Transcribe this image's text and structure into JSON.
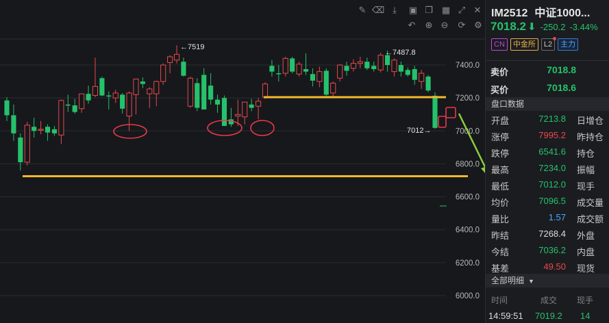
{
  "toolbar": {
    "row1": [
      "pencil-icon",
      "erase-icon",
      "save-icon",
      "camera-icon",
      "copy-icon",
      "grid-icon",
      "expand-icon",
      "close-icon"
    ],
    "row2": [
      "undo-icon",
      "zoom-in-icon",
      "zoom-out-icon",
      "reset-icon",
      "settings-icon"
    ]
  },
  "chart_data": {
    "type": "candlestick",
    "y_ticks": [
      "7400.0",
      "7200.0",
      "7000.0",
      "6800.0",
      "6600.0",
      "6400.0",
      "6200.0",
      "6000.0"
    ],
    "ylim": [
      5960,
      7560
    ],
    "grid": true,
    "candles": [
      {
        "o": 7185,
        "h": 7205,
        "l": 7060,
        "c": 7095
      },
      {
        "o": 7095,
        "h": 7160,
        "l": 6940,
        "c": 6985
      },
      {
        "o": 6960,
        "h": 6985,
        "l": 6760,
        "c": 6810
      },
      {
        "o": 6810,
        "h": 7055,
        "l": 6790,
        "c": 7035
      },
      {
        "o": 7025,
        "h": 7080,
        "l": 6960,
        "c": 7000
      },
      {
        "o": 7010,
        "h": 7060,
        "l": 6980,
        "c": 7010
      },
      {
        "o": 7025,
        "h": 7040,
        "l": 6940,
        "c": 6990
      },
      {
        "o": 7010,
        "h": 7030,
        "l": 6970,
        "c": 6985
      },
      {
        "o": 6975,
        "h": 7190,
        "l": 6920,
        "c": 7185
      },
      {
        "o": 7160,
        "h": 7220,
        "l": 7115,
        "c": 7155
      },
      {
        "o": 7155,
        "h": 7195,
        "l": 7105,
        "c": 7115
      },
      {
        "o": 7135,
        "h": 7225,
        "l": 7110,
        "c": 7225
      },
      {
        "o": 7225,
        "h": 7275,
        "l": 7165,
        "c": 7185
      },
      {
        "o": 7215,
        "h": 7445,
        "l": 7205,
        "c": 7270
      },
      {
        "o": 7320,
        "h": 7330,
        "l": 7210,
        "c": 7215
      },
      {
        "o": 7215,
        "h": 7240,
        "l": 7130,
        "c": 7210
      },
      {
        "o": 7200,
        "h": 7250,
        "l": 7170,
        "c": 7230
      },
      {
        "o": 7220,
        "h": 7230,
        "l": 7105,
        "c": 7135
      },
      {
        "o": 7090,
        "h": 7240,
        "l": 7000,
        "c": 7230
      },
      {
        "o": 7220,
        "h": 7290,
        "l": 7100,
        "c": 7315
      },
      {
        "o": 7300,
        "h": 7325,
        "l": 7260,
        "c": 7285
      },
      {
        "o": 7225,
        "h": 7265,
        "l": 7140,
        "c": 7255
      },
      {
        "o": 7225,
        "h": 7305,
        "l": 7150,
        "c": 7300
      },
      {
        "o": 7300,
        "h": 7410,
        "l": 7280,
        "c": 7400
      },
      {
        "o": 7415,
        "h": 7460,
        "l": 7350,
        "c": 7450
      },
      {
        "o": 7430,
        "h": 7519,
        "l": 7410,
        "c": 7465
      },
      {
        "o": 7420,
        "h": 7445,
        "l": 7330,
        "c": 7335
      },
      {
        "o": 7150,
        "h": 7330,
        "l": 7140,
        "c": 7320
      },
      {
        "o": 7290,
        "h": 7320,
        "l": 7120,
        "c": 7140
      },
      {
        "o": 7340,
        "h": 7380,
        "l": 7130,
        "c": 7130
      },
      {
        "o": 7275,
        "h": 7350,
        "l": 7160,
        "c": 7190
      },
      {
        "o": 7190,
        "h": 7220,
        "l": 7110,
        "c": 7160
      },
      {
        "o": 7200,
        "h": 7215,
        "l": 7030,
        "c": 7030
      },
      {
        "o": 7070,
        "h": 7140,
        "l": 7025,
        "c": 7040
      },
      {
        "o": 7090,
        "h": 7190,
        "l": 7030,
        "c": 7100
      },
      {
        "o": 7085,
        "h": 7140,
        "l": 7040,
        "c": 7175
      },
      {
        "o": 7160,
        "h": 7195,
        "l": 7120,
        "c": 7140
      },
      {
        "o": 7150,
        "h": 7200,
        "l": 7070,
        "c": 7180
      },
      {
        "o": 7205,
        "h": 7295,
        "l": 7195,
        "c": 7285
      },
      {
        "o": 7395,
        "h": 7430,
        "l": 7330,
        "c": 7360
      },
      {
        "o": 7350,
        "h": 7400,
        "l": 7300,
        "c": 7345
      },
      {
        "o": 7350,
        "h": 7450,
        "l": 7330,
        "c": 7440
      },
      {
        "o": 7440,
        "h": 7450,
        "l": 7350,
        "c": 7360
      },
      {
        "o": 7345,
        "h": 7420,
        "l": 7330,
        "c": 7405
      },
      {
        "o": 7375,
        "h": 7470,
        "l": 7340,
        "c": 7360
      },
      {
        "o": 7345,
        "h": 7380,
        "l": 7270,
        "c": 7305
      },
      {
        "o": 7300,
        "h": 7390,
        "l": 7265,
        "c": 7360
      },
      {
        "o": 7365,
        "h": 7380,
        "l": 7210,
        "c": 7220
      },
      {
        "o": 7230,
        "h": 7300,
        "l": 7205,
        "c": 7290
      },
      {
        "o": 7320,
        "h": 7405,
        "l": 7300,
        "c": 7400
      },
      {
        "o": 7395,
        "h": 7420,
        "l": 7335,
        "c": 7365
      },
      {
        "o": 7380,
        "h": 7435,
        "l": 7360,
        "c": 7410
      },
      {
        "o": 7410,
        "h": 7450,
        "l": 7380,
        "c": 7420
      },
      {
        "o": 7420,
        "h": 7445,
        "l": 7370,
        "c": 7380
      },
      {
        "o": 7395,
        "h": 7420,
        "l": 7360,
        "c": 7375
      },
      {
        "o": 7370,
        "h": 7475,
        "l": 7355,
        "c": 7460
      },
      {
        "o": 7460,
        "h": 7487.8,
        "l": 7360,
        "c": 7400
      },
      {
        "o": 7360,
        "h": 7440,
        "l": 7330,
        "c": 7430
      },
      {
        "o": 7400,
        "h": 7420,
        "l": 7330,
        "c": 7360
      },
      {
        "o": 7370,
        "h": 7385,
        "l": 7330,
        "c": 7340
      },
      {
        "o": 7375,
        "h": 7395,
        "l": 7280,
        "c": 7310
      },
      {
        "o": 7300,
        "h": 7370,
        "l": 7255,
        "c": 7350
      },
      {
        "o": 7330,
        "h": 7340,
        "l": 7235,
        "c": 7245
      },
      {
        "o": 7213.8,
        "h": 7234,
        "l": 7012,
        "c": 7018.2
      }
    ],
    "annotations": [
      {
        "label": "←7519",
        "value": 7519
      },
      {
        "label": "←7487.8",
        "value": 7487.8
      },
      {
        "label": "7012→",
        "value": 7012
      }
    ],
    "support_lines": [
      7205,
      6725
    ]
  },
  "quote": {
    "code": "IM2512",
    "name": "中证1000...",
    "price": "7018.2",
    "change": "-250.2",
    "change_pct": "-3.44%",
    "tags": {
      "cn": "CN",
      "exchange": "中金所",
      "l2": "L2",
      "main": "主力"
    },
    "sell_label": "卖价",
    "sell_value": "7018.8",
    "buy_label": "买价",
    "buy_value": "7018.6",
    "panel_title": "盘口数据",
    "rows": [
      {
        "l": "开盘",
        "v": "7213.8",
        "c": "green",
        "r": "日增仓"
      },
      {
        "l": "涨停",
        "v": "7995.2",
        "c": "red",
        "r": "昨持仓"
      },
      {
        "l": "跌停",
        "v": "6541.6",
        "c": "green",
        "r": "持仓"
      },
      {
        "l": "最高",
        "v": "7234.0",
        "c": "green",
        "r": "振幅"
      },
      {
        "l": "最低",
        "v": "7012.0",
        "c": "green",
        "r": "现手"
      },
      {
        "l": "均价",
        "v": "7096.5",
        "c": "green",
        "r": "成交量"
      },
      {
        "l": "量比",
        "v": "1.57",
        "c": "blue",
        "r": "成交额"
      },
      {
        "l": "昨结",
        "v": "7268.4",
        "c": "white",
        "r": "外盘"
      },
      {
        "l": "今结",
        "v": "7036.2",
        "c": "green",
        "r": "内盘"
      },
      {
        "l": "基差",
        "v": "49.50",
        "c": "red",
        "r": "现货"
      }
    ],
    "detail_title": "全部明细",
    "trades_head": {
      "time": "时间",
      "deal": "成交",
      "hands": "现手"
    },
    "trade": {
      "time": "14:59:51",
      "price": "7019.2",
      "hands": "14"
    }
  }
}
